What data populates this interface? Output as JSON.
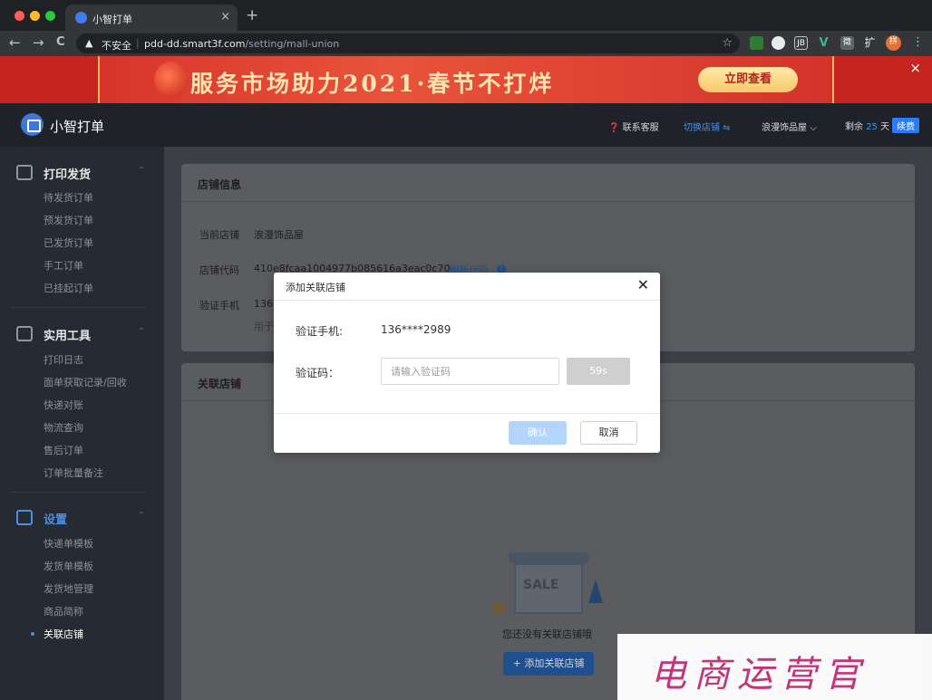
{
  "browser": {
    "tab_title": "小智打单",
    "tab_close": "×",
    "new_tab": "+",
    "back": "←",
    "forward": "→",
    "reload": "C",
    "security_warning": "▲",
    "insecure_label": "不安全",
    "url_host": "pdd-dd.smart3f.com",
    "url_path": "/setting/mall-union",
    "bookmark_star": "☆",
    "extensions": [
      "JB",
      "V",
      "徵",
      "扩",
      "拼"
    ]
  },
  "banner": {
    "text": "服务市场助力2021·春节不打烊",
    "button": "立即查看",
    "close": "×"
  },
  "header": {
    "app_name": "小智打单",
    "support": "联系客服",
    "switch_store": "切换店铺 ⇋",
    "store_name": "浪漫饰品屋",
    "remaining_prefix": "剩余",
    "remaining_days": "25",
    "remaining_suffix": "天",
    "renew": "续费"
  },
  "sidebar": {
    "sections": [
      {
        "title": "打印发货",
        "items": [
          "待发货订单",
          "预发货订单",
          "已发货订单",
          "手工订单",
          "已挂起订单"
        ]
      },
      {
        "title": "实用工具",
        "items": [
          "打印日志",
          "面单获取记录/回收",
          "快递对账",
          "物流查询",
          "售后订单",
          "订单批量备注"
        ]
      },
      {
        "title": "设置",
        "items": [
          "快递单模板",
          "发货单模板",
          "发货地管理",
          "商品简称",
          "关联店铺"
        ]
      }
    ],
    "toggle": "‹"
  },
  "store_info": {
    "title": "店铺信息",
    "current_store_label": "当前店铺",
    "current_store_value": "浪漫饰品屋",
    "store_code_label": "店铺代码",
    "store_code_value": "410e8fcaa1004977b085616a3eac0c70",
    "refresh_code": "刷新代码",
    "info_icon": "!",
    "verify_phone_label": "验证手机",
    "verify_phone_value": "136",
    "note_partial": "用于"
  },
  "linked_stores": {
    "title": "关联店铺",
    "empty_text": "您还没有关联店铺哦",
    "add_button": "+ 添加关联店铺",
    "illustration_text": "SALE"
  },
  "modal": {
    "title": "添加关联店铺",
    "close": "✕",
    "phone_label": "验证手机:",
    "phone_value": "136****2989",
    "code_label": "验证码：",
    "code_placeholder": "请输入验证码",
    "countdown": "59s",
    "confirm": "确认",
    "cancel": "取消"
  },
  "watermark": {
    "text": "电商运营官"
  },
  "colors": {
    "accent": "#2d7bf4",
    "banner_red": "#c6241e",
    "sidebar_bg": "#262a33"
  }
}
